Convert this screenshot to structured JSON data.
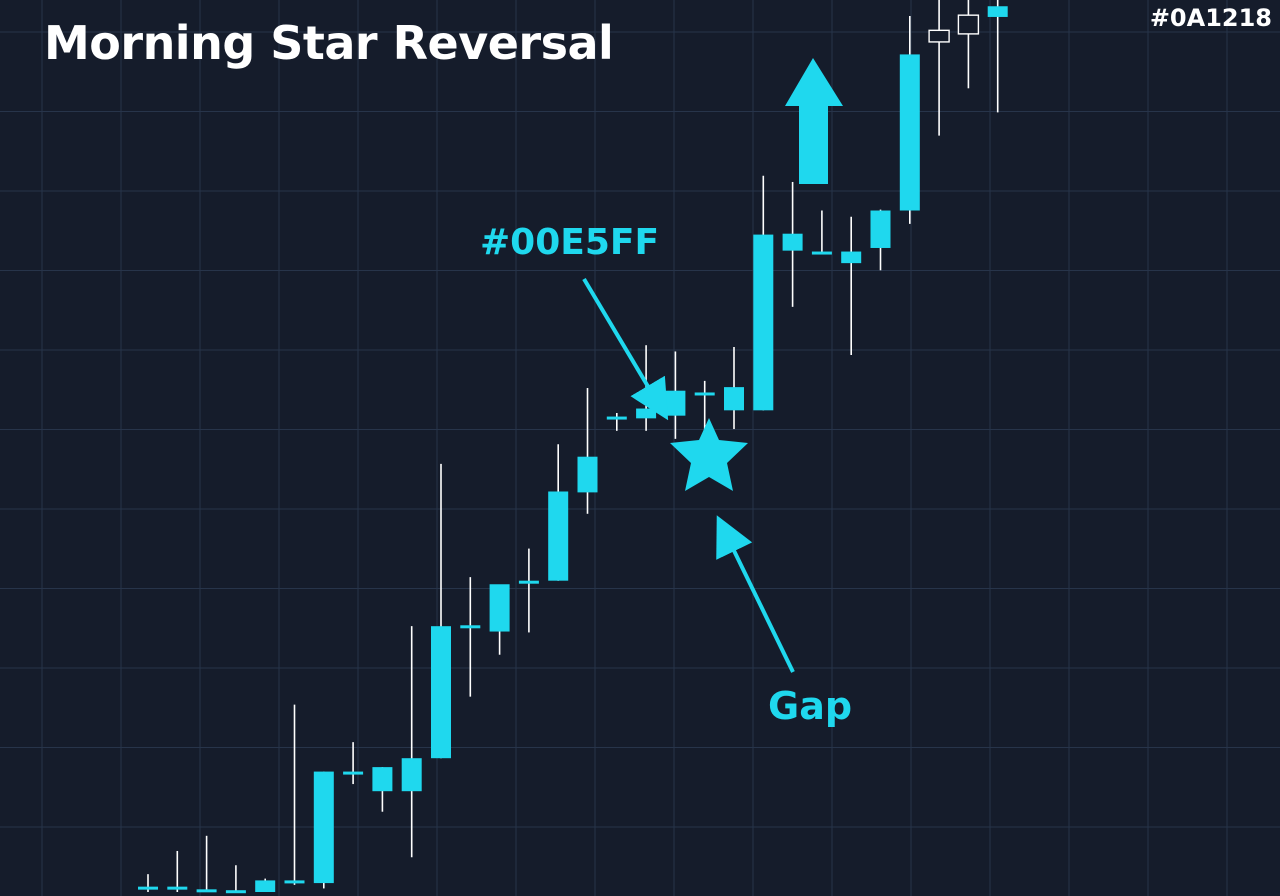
{
  "colors": {
    "background": "#151c2b",
    "grid": "#27344a",
    "accent": "#1fd8ee",
    "wick": "#ffffff",
    "text": "#ffffff"
  },
  "header": {
    "title": "Morning Star Reversal",
    "corner_tag": "#0A1218"
  },
  "annotations": {
    "color_label": "#00E5FF",
    "gap_label": "Gap",
    "icons": [
      "star-icon",
      "arrow-up-icon",
      "pointer-arrow-icon"
    ]
  },
  "chart_data": {
    "type": "candlestick",
    "title": "Morning Star Reversal",
    "xlabel": "",
    "ylabel": "",
    "ylim": [
      0,
      100
    ],
    "grid": true,
    "legend": "none",
    "candles": [
      {
        "o": 0.4,
        "h": 2.0,
        "l": 0.0,
        "c": 0.6,
        "filled": true
      },
      {
        "o": 0.3,
        "h": 4.6,
        "l": 0.0,
        "c": 0.6,
        "filled": true
      },
      {
        "o": 0.0,
        "h": 6.3,
        "l": 0.0,
        "c": 0.3,
        "filled": true
      },
      {
        "o": 0.2,
        "h": 3.0,
        "l": 0.0,
        "c": 0.2,
        "filled": true
      },
      {
        "o": 0.0,
        "h": 1.5,
        "l": 0.0,
        "c": 1.3,
        "filled": true
      },
      {
        "o": 1.1,
        "h": 21.0,
        "l": 0.8,
        "c": 1.3,
        "filled": true
      },
      {
        "o": 1.0,
        "h": 13.5,
        "l": 0.4,
        "c": 13.5,
        "filled": true
      },
      {
        "o": 13.3,
        "h": 16.8,
        "l": 12.1,
        "c": 13.5,
        "filled": true
      },
      {
        "o": 11.3,
        "h": 14.0,
        "l": 9.0,
        "c": 14.0,
        "filled": true
      },
      {
        "o": 11.3,
        "h": 29.8,
        "l": 3.9,
        "c": 15.0,
        "filled": true
      },
      {
        "o": 15.0,
        "h": 48.0,
        "l": 15.0,
        "c": 29.8,
        "filled": true
      },
      {
        "o": 29.6,
        "h": 35.3,
        "l": 21.9,
        "c": 29.9,
        "filled": true
      },
      {
        "o": 29.2,
        "h": 34.1,
        "l": 26.6,
        "c": 34.5,
        "filled": true
      },
      {
        "o": 34.8,
        "h": 38.5,
        "l": 29.1,
        "c": 34.9,
        "filled": true
      },
      {
        "o": 34.9,
        "h": 50.2,
        "l": 34.9,
        "c": 44.9,
        "filled": true
      },
      {
        "o": 44.8,
        "h": 56.5,
        "l": 42.4,
        "c": 48.8,
        "filled": true
      },
      {
        "o": 53.0,
        "h": 53.7,
        "l": 51.7,
        "c": 53.3,
        "filled": true
      },
      {
        "o": 53.1,
        "h": 61.3,
        "l": 51.7,
        "c": 54.2,
        "filled": true
      },
      {
        "o": 53.4,
        "h": 60.6,
        "l": 50.8,
        "c": 56.2,
        "filled": true
      },
      {
        "o": 56.0,
        "h": 57.3,
        "l": 50.8,
        "c": 56.0,
        "filled": true
      },
      {
        "o": 54.0,
        "h": 61.1,
        "l": 51.9,
        "c": 56.6,
        "filled": true
      },
      {
        "o": 54.0,
        "h": 80.3,
        "l": 54.0,
        "c": 73.7,
        "filled": true
      },
      {
        "o": 71.9,
        "h": 79.6,
        "l": 65.6,
        "c": 73.8,
        "filled": true
      },
      {
        "o": 71.8,
        "h": 76.4,
        "l": 71.5,
        "c": 71.7,
        "filled": true
      },
      {
        "o": 70.5,
        "h": 75.7,
        "l": 60.2,
        "c": 71.8,
        "filled": true
      },
      {
        "o": 72.2,
        "h": 76.5,
        "l": 69.7,
        "c": 76.4,
        "filled": true
      },
      {
        "o": 76.4,
        "h": 98.2,
        "l": 74.9,
        "c": 93.9,
        "filled": true
      },
      {
        "o": 95.3,
        "h": 100.0,
        "l": 84.8,
        "c": 96.6,
        "filled": false
      },
      {
        "o": 96.2,
        "h": 100.0,
        "l": 90.1,
        "c": 98.3,
        "filled": false
      },
      {
        "o": 98.1,
        "h": 100.0,
        "l": 87.4,
        "c": 99.3,
        "filled": true
      }
    ]
  }
}
